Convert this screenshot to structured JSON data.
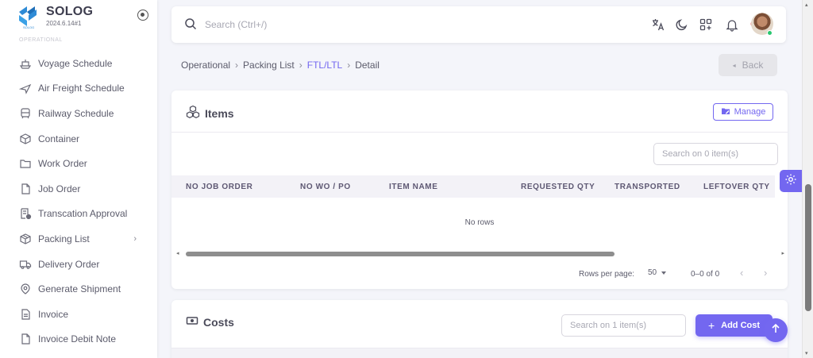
{
  "colors": {
    "primary": "#7367f0",
    "background": "#f4f5fa",
    "online": "#28c76f",
    "notification": "#ea5455"
  },
  "brand": {
    "name": "SOLOG",
    "version": "2024.6.14#1",
    "logo_text": "SOLOG",
    "logo_icon": "solog-logo-icon",
    "pin_icon": "radio-circle-icon"
  },
  "sidebar": {
    "section_label": "OPERATIONAL",
    "items": [
      {
        "label": "Voyage Schedule",
        "icon": "ship-icon"
      },
      {
        "label": "Air Freight Schedule",
        "icon": "plane-icon"
      },
      {
        "label": "Railway Schedule",
        "icon": "train-icon"
      },
      {
        "label": "Container",
        "icon": "box-icon"
      },
      {
        "label": "Work Order",
        "icon": "folder-icon"
      },
      {
        "label": "Job Order",
        "icon": "file-icon"
      },
      {
        "label": "Transcation Approval",
        "icon": "file-check-icon"
      },
      {
        "label": "Packing List",
        "icon": "package-icon",
        "has_children": true
      },
      {
        "label": "Delivery Order",
        "icon": "truck-icon"
      },
      {
        "label": "Generate Shipment",
        "icon": "shipment-icon"
      },
      {
        "label": "Invoice",
        "icon": "invoice-icon"
      },
      {
        "label": "Invoice Debit Note",
        "icon": "file-icon"
      }
    ]
  },
  "topbar": {
    "search_placeholder": "Search (Ctrl+/)",
    "icons": [
      "translate-icon",
      "moon-icon",
      "apps-add-icon",
      "bell-icon"
    ],
    "notification_badge": true,
    "avatar": "user-avatar",
    "online": true
  },
  "breadcrumb": {
    "items": [
      "Operational",
      "Packing List",
      "FTL/LTL",
      "Detail"
    ],
    "active_index": 2,
    "separator": "›"
  },
  "back_button": {
    "label": "Back",
    "icon": "chevron-left-icon",
    "disabled": true
  },
  "items_card": {
    "title": "Items",
    "title_icon": "cubes-icon",
    "manage_label": "Manage",
    "manage_icon": "folder-edit-icon",
    "search_placeholder": "Search on 0 item(s)",
    "columns": [
      "NO JOB ORDER",
      "NO WO / PO",
      "ITEM NAME",
      "REQUESTED QTY",
      "TRANSPORTED",
      "LEFTOVER QTY"
    ],
    "rows": [],
    "empty_text": "No rows",
    "pagination": {
      "rows_per_page_label": "Rows per page:",
      "rows_per_page": "50",
      "range": "0–0 of 0"
    }
  },
  "costs_card": {
    "title": "Costs",
    "title_icon": "cash-icon",
    "search_placeholder": "Search on 1 item(s)",
    "add_label": "Add Cost"
  },
  "floating": {
    "settings_icon": "gear-icon",
    "scroll_top_icon": "arrow-up-icon"
  }
}
